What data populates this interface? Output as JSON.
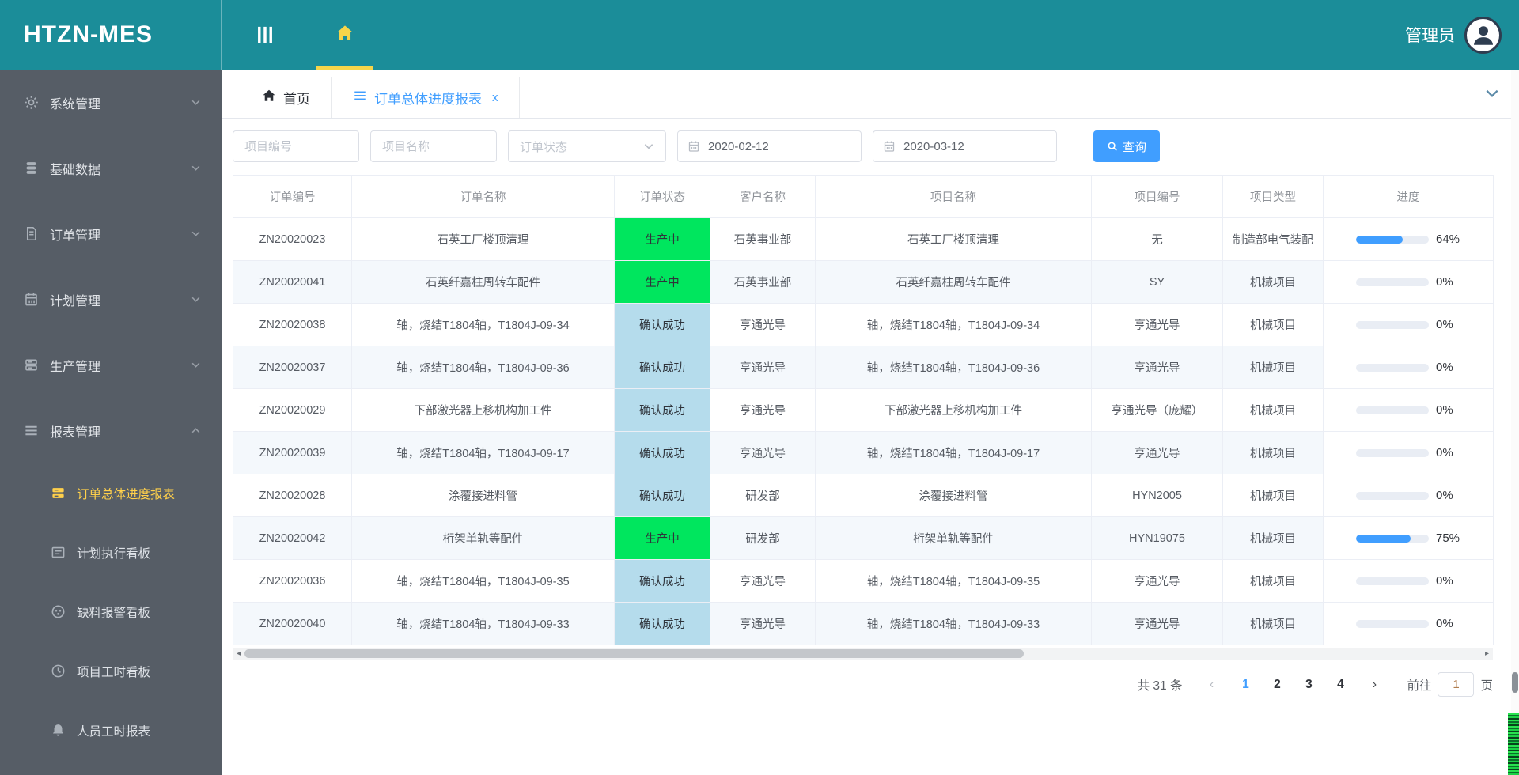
{
  "brand": "HTZN-MES",
  "header": {
    "user_name": "管理员"
  },
  "tabs": {
    "items": [
      {
        "key": "home",
        "label": "首页",
        "icon": "home",
        "active": false,
        "closable": false
      },
      {
        "key": "order-progress-report",
        "label": "订单总体进度报表",
        "icon": "report",
        "active": true,
        "closable": true
      }
    ],
    "close_glyph": "x"
  },
  "sidebar": {
    "items": [
      {
        "key": "system-management",
        "label": "系统管理",
        "icon": "gear",
        "expanded": false
      },
      {
        "key": "basic-data",
        "label": "基础数据",
        "icon": "database",
        "expanded": false
      },
      {
        "key": "order-management",
        "label": "订单管理",
        "icon": "document",
        "expanded": false
      },
      {
        "key": "plan-management",
        "label": "计划管理",
        "icon": "calendar",
        "expanded": false
      },
      {
        "key": "production-management",
        "label": "生产管理",
        "icon": "production",
        "expanded": false
      },
      {
        "key": "report-management",
        "label": "报表管理",
        "icon": "report",
        "expanded": true,
        "children": [
          {
            "key": "order-progress-report",
            "label": "订单总体进度报表",
            "icon": "order-progress",
            "active": true
          },
          {
            "key": "plan-execution-board",
            "label": "计划执行看板",
            "icon": "plan-board",
            "active": false
          },
          {
            "key": "shortage-alarm-board",
            "label": "缺料报警看板",
            "icon": "shortage-alarm",
            "active": false
          },
          {
            "key": "project-hours-board",
            "label": "项目工时看板",
            "icon": "project-hours",
            "active": false
          },
          {
            "key": "personnel-hours-report",
            "label": "人员工时报表",
            "icon": "personnel-hours",
            "active": false
          }
        ]
      }
    ]
  },
  "filters": {
    "project_no_placeholder": "项目编号",
    "project_name_placeholder": "项目名称",
    "order_status_placeholder": "订单状态",
    "start_date": "2020-02-12",
    "end_date": "2020-03-12",
    "search_label": "查询"
  },
  "statuses": {
    "producing": {
      "label": "生产中",
      "color": "#00e65e"
    },
    "confirmed": {
      "label": "确认成功",
      "color": "#b5dcec"
    }
  },
  "table": {
    "columns": [
      "订单编号",
      "订单名称",
      "订单状态",
      "客户名称",
      "项目名称",
      "项目编号",
      "项目类型",
      "进度"
    ],
    "rows": [
      {
        "order_no": "ZN20020023",
        "order_name": "石英工厂楼顶清理",
        "status": "生产中",
        "status_type": "producing",
        "customer": "石英事业部",
        "project_name": "石英工厂楼顶清理",
        "project_no": "无",
        "project_type": "制造部电气装配",
        "progress_pct": 64
      },
      {
        "order_no": "ZN20020041",
        "order_name": "石英纤嘉柱周转车配件",
        "status": "生产中",
        "status_type": "producing",
        "customer": "石英事业部",
        "project_name": "石英纤嘉柱周转车配件",
        "project_no": "SY",
        "project_type": "机械项目",
        "progress_pct": 0
      },
      {
        "order_no": "ZN20020038",
        "order_name": "轴，烧结T1804轴，T1804J-09-34",
        "status": "确认成功",
        "status_type": "confirmed",
        "customer": "亨通光导",
        "project_name": "轴，烧结T1804轴，T1804J-09-34",
        "project_no": "亨通光导",
        "project_type": "机械项目",
        "progress_pct": 0
      },
      {
        "order_no": "ZN20020037",
        "order_name": "轴，烧结T1804轴，T1804J-09-36",
        "status": "确认成功",
        "status_type": "confirmed",
        "customer": "亨通光导",
        "project_name": "轴，烧结T1804轴，T1804J-09-36",
        "project_no": "亨通光导",
        "project_type": "机械项目",
        "progress_pct": 0
      },
      {
        "order_no": "ZN20020029",
        "order_name": "下部激光器上移机构加工件",
        "status": "确认成功",
        "status_type": "confirmed",
        "customer": "亨通光导",
        "project_name": "下部激光器上移机构加工件",
        "project_no": "亨通光导（庞耀）",
        "project_type": "机械项目",
        "progress_pct": 0
      },
      {
        "order_no": "ZN20020039",
        "order_name": "轴，烧结T1804轴，T1804J-09-17",
        "status": "确认成功",
        "status_type": "confirmed",
        "customer": "亨通光导",
        "project_name": "轴，烧结T1804轴，T1804J-09-17",
        "project_no": "亨通光导",
        "project_type": "机械项目",
        "progress_pct": 0
      },
      {
        "order_no": "ZN20020028",
        "order_name": "涂覆接进料管",
        "status": "确认成功",
        "status_type": "confirmed",
        "customer": "研发部",
        "project_name": "涂覆接进料管",
        "project_no": "HYN2005",
        "project_type": "机械项目",
        "progress_pct": 0
      },
      {
        "order_no": "ZN20020042",
        "order_name": "桁架单轨等配件",
        "status": "生产中",
        "status_type": "producing",
        "customer": "研发部",
        "project_name": "桁架单轨等配件",
        "project_no": "HYN19075",
        "project_type": "机械项目",
        "progress_pct": 75
      },
      {
        "order_no": "ZN20020036",
        "order_name": "轴，烧结T1804轴，T1804J-09-35",
        "status": "确认成功",
        "status_type": "confirmed",
        "customer": "亨通光导",
        "project_name": "轴，烧结T1804轴，T1804J-09-35",
        "project_no": "亨通光导",
        "project_type": "机械项目",
        "progress_pct": 0
      },
      {
        "order_no": "ZN20020040",
        "order_name": "轴，烧结T1804轴，T1804J-09-33",
        "status": "确认成功",
        "status_type": "confirmed",
        "customer": "亨通光导",
        "project_name": "轴，烧结T1804轴，T1804J-09-33",
        "project_no": "亨通光导",
        "project_type": "机械项目",
        "progress_pct": 0
      }
    ]
  },
  "pagination": {
    "total_label": "共 31 条",
    "prev_glyph": "‹",
    "next_glyph": "›",
    "pages": [
      "1",
      "2",
      "3",
      "4"
    ],
    "current_page": "1",
    "goto_label": "前往",
    "goto_value": "1",
    "page_unit": "页"
  },
  "colors": {
    "header_teal": "#1b8d99",
    "sidebar_dark": "#565d66",
    "accent_blue": "#409eff",
    "active_yellow": "#ffd04b",
    "status_green": "#00e65e",
    "status_lightblue": "#b5dcec"
  }
}
